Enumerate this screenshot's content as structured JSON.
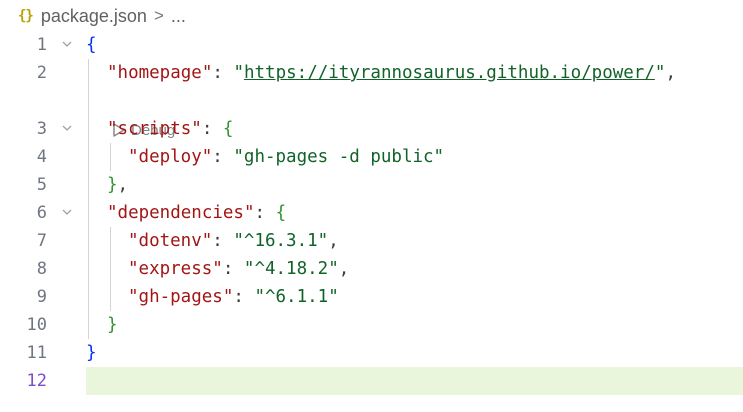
{
  "breadcrumb": {
    "icon": "json-braces-icon",
    "icon_text": "{}",
    "file": "package.json",
    "separator": ">",
    "more": "..."
  },
  "codelens": {
    "label": "Debug"
  },
  "editor": {
    "active_line": "12",
    "lines": [
      {
        "number": "1"
      },
      {
        "number": "2"
      },
      {
        "number": "3"
      },
      {
        "number": "4"
      },
      {
        "number": "5"
      },
      {
        "number": "6"
      },
      {
        "number": "7"
      },
      {
        "number": "8"
      },
      {
        "number": "9"
      },
      {
        "number": "10"
      },
      {
        "number": "11"
      },
      {
        "number": "12"
      }
    ],
    "tokens": {
      "open_root": "{",
      "homepage_key": "\"homepage\"",
      "homepage_url": "https://ityrannosaurus.github.io/power/",
      "scripts_key": "\"scripts\"",
      "deploy_key": "\"deploy\"",
      "deploy_val": "\"gh-pages -d public\"",
      "dependencies_key": "\"dependencies\"",
      "dotenv_key": "\"dotenv\"",
      "dotenv_val": "\"^16.3.1\"",
      "express_key": "\"express\"",
      "express_val": "\"^4.18.2\"",
      "ghpages_key": "\"gh-pages\"",
      "ghpages_val": "\"^6.1.1\"",
      "close_root": "}"
    }
  },
  "colors": {
    "key": "#a31515",
    "string_value": "#116329",
    "root_brace": "#0431fa",
    "nested_brace": "#319331",
    "current_line": "#eaf6dc",
    "active_line_number": "#7c4dcf"
  }
}
